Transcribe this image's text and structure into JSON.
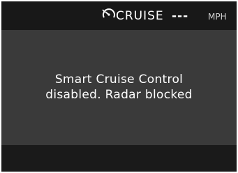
{
  "status_bar": {
    "icon": "cruise-control-speedometer-icon",
    "cruise_label": "CRUISE",
    "speed_value": "---",
    "speed_unit": "MPH"
  },
  "message": {
    "line1": "Smart Cruise Control",
    "line2": "disabled. Radar blocked"
  },
  "colors": {
    "screen_background": "#3a3a3a",
    "status_bar_background": "#181818",
    "text": "#ffffff"
  }
}
